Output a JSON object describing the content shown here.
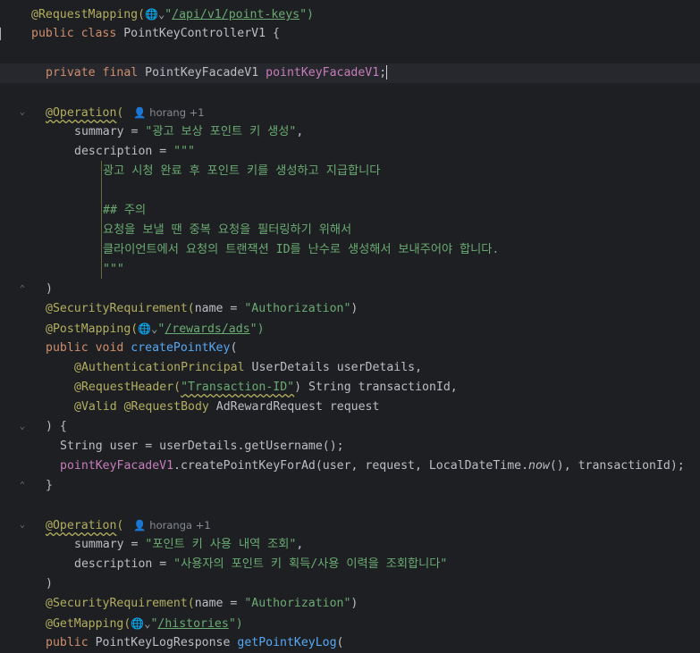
{
  "editor": {
    "lines": [
      {
        "segments": [
          {
            "t": "@RequestMapping(",
            "c": "ann"
          },
          {
            "t": "🌐⌄",
            "c": "globe"
          },
          {
            "t": "\"",
            "c": "str"
          },
          {
            "t": "/api/v1/point-keys",
            "c": "url"
          },
          {
            "t": "\")",
            "c": "str"
          }
        ]
      },
      {
        "segments": [
          {
            "t": "public class ",
            "c": "kw"
          },
          {
            "t": "PointKeyControllerV1 {",
            "c": "plain"
          }
        ]
      },
      {
        "segments": []
      },
      {
        "segments": [
          {
            "t": "private final ",
            "c": "kw"
          },
          {
            "t": "PointKeyFacadeV1 ",
            "c": "plain"
          },
          {
            "t": "pointKeyFacadeV1",
            "c": "fld"
          },
          {
            "t": ";",
            "c": "plain"
          }
        ]
      },
      {
        "segments": []
      },
      {
        "segments": [
          {
            "t": "@Operation",
            "c": "ann squig"
          },
          {
            "t": "(",
            "c": "ann"
          },
          {
            "t": "   👤 horang +1",
            "c": "inlay"
          }
        ]
      },
      {
        "segments": [
          {
            "t": "summary = ",
            "c": "plain"
          },
          {
            "t": "\"광고 보상 포인트 키 생성\"",
            "c": "str"
          },
          {
            "t": ",",
            "c": "plain"
          }
        ]
      },
      {
        "segments": [
          {
            "t": "description = ",
            "c": "plain"
          },
          {
            "t": "\"\"\"",
            "c": "str"
          }
        ]
      },
      {
        "segments": [
          {
            "t": "광고 시청 완료 후 포인트 키를 생성하고 지급합니다",
            "c": "str"
          }
        ]
      },
      {
        "segments": []
      },
      {
        "segments": [
          {
            "t": "## 주의",
            "c": "str"
          }
        ]
      },
      {
        "segments": [
          {
            "t": "요청을 보낼 땐 중복 요청을 필터링하기 위해서",
            "c": "str"
          }
        ]
      },
      {
        "segments": [
          {
            "t": "클라이언트에서 요청의 트랜잭션 ID를 난수로 생성해서 보내주어야 합니다.",
            "c": "str"
          }
        ]
      },
      {
        "segments": [
          {
            "t": "\"\"\"",
            "c": "str"
          }
        ]
      },
      {
        "segments": [
          {
            "t": ")",
            "c": "plain"
          }
        ]
      },
      {
        "segments": [
          {
            "t": "@SecurityRequirement(",
            "c": "ann"
          },
          {
            "t": "name = ",
            "c": "plain"
          },
          {
            "t": "\"Authorization\"",
            "c": "str"
          },
          {
            "t": ")",
            "c": "plain"
          }
        ]
      },
      {
        "segments": [
          {
            "t": "@PostMapping(",
            "c": "ann"
          },
          {
            "t": "🌐⌄",
            "c": "globe"
          },
          {
            "t": "\"",
            "c": "str"
          },
          {
            "t": "/rewards/ads",
            "c": "url"
          },
          {
            "t": "\")",
            "c": "str"
          }
        ]
      },
      {
        "segments": [
          {
            "t": "public void ",
            "c": "kw"
          },
          {
            "t": "createPointKey",
            "c": "fn"
          },
          {
            "t": "(",
            "c": "plain"
          }
        ]
      },
      {
        "segments": [
          {
            "t": "@AuthenticationPrincipal ",
            "c": "ann"
          },
          {
            "t": "UserDetails userDetails,",
            "c": "plain"
          }
        ]
      },
      {
        "segments": [
          {
            "t": "@RequestHeader(",
            "c": "ann"
          },
          {
            "t": "\"Transaction-ID\"",
            "c": "str squig"
          },
          {
            "t": ") String transactionId,",
            "c": "plain"
          }
        ]
      },
      {
        "segments": [
          {
            "t": "@Valid @RequestBody ",
            "c": "ann"
          },
          {
            "t": "AdRewardRequest request",
            "c": "plain"
          }
        ]
      },
      {
        "segments": [
          {
            "t": ") {",
            "c": "plain"
          }
        ]
      },
      {
        "segments": [
          {
            "t": "String user = userDetails.getUsername();",
            "c": "plain"
          }
        ]
      },
      {
        "segments": [
          {
            "t": "pointKeyFacadeV1",
            "c": "fld"
          },
          {
            "t": ".createPointKeyForAd(user, request, LocalDateTime.",
            "c": "plain"
          },
          {
            "t": "now",
            "c": "ital"
          },
          {
            "t": "(), transactionId);",
            "c": "plain"
          }
        ]
      },
      {
        "segments": [
          {
            "t": "}",
            "c": "plain"
          }
        ]
      },
      {
        "segments": []
      },
      {
        "segments": [
          {
            "t": "@Operation",
            "c": "ann squig"
          },
          {
            "t": "(",
            "c": "ann"
          },
          {
            "t": "   👤 horanga +1",
            "c": "inlay"
          }
        ]
      },
      {
        "segments": [
          {
            "t": "summary = ",
            "c": "plain"
          },
          {
            "t": "\"포인트 키 사용 내역 조회\"",
            "c": "str"
          },
          {
            "t": ",",
            "c": "plain"
          }
        ]
      },
      {
        "segments": [
          {
            "t": "description = ",
            "c": "plain"
          },
          {
            "t": "\"사용자의 포인트 키 획득/사용 이력을 조회합니다\"",
            "c": "str"
          }
        ]
      },
      {
        "segments": [
          {
            "t": ")",
            "c": "plain"
          }
        ]
      },
      {
        "segments": [
          {
            "t": "@SecurityRequirement(",
            "c": "ann"
          },
          {
            "t": "name = ",
            "c": "plain"
          },
          {
            "t": "\"Authorization\"",
            "c": "str"
          },
          {
            "t": ")",
            "c": "plain"
          }
        ]
      },
      {
        "segments": [
          {
            "t": "@GetMapping(",
            "c": "ann"
          },
          {
            "t": "🌐⌄",
            "c": "globe"
          },
          {
            "t": "\"",
            "c": "str"
          },
          {
            "t": "/histories",
            "c": "url"
          },
          {
            "t": "\")",
            "c": "str"
          }
        ]
      },
      {
        "segments": [
          {
            "t": "public ",
            "c": "kw"
          },
          {
            "t": "PointKeyLogResponse ",
            "c": "plain"
          },
          {
            "t": "getPointKeyLog",
            "c": "fn"
          },
          {
            "t": "(",
            "c": "plain"
          }
        ]
      }
    ]
  }
}
